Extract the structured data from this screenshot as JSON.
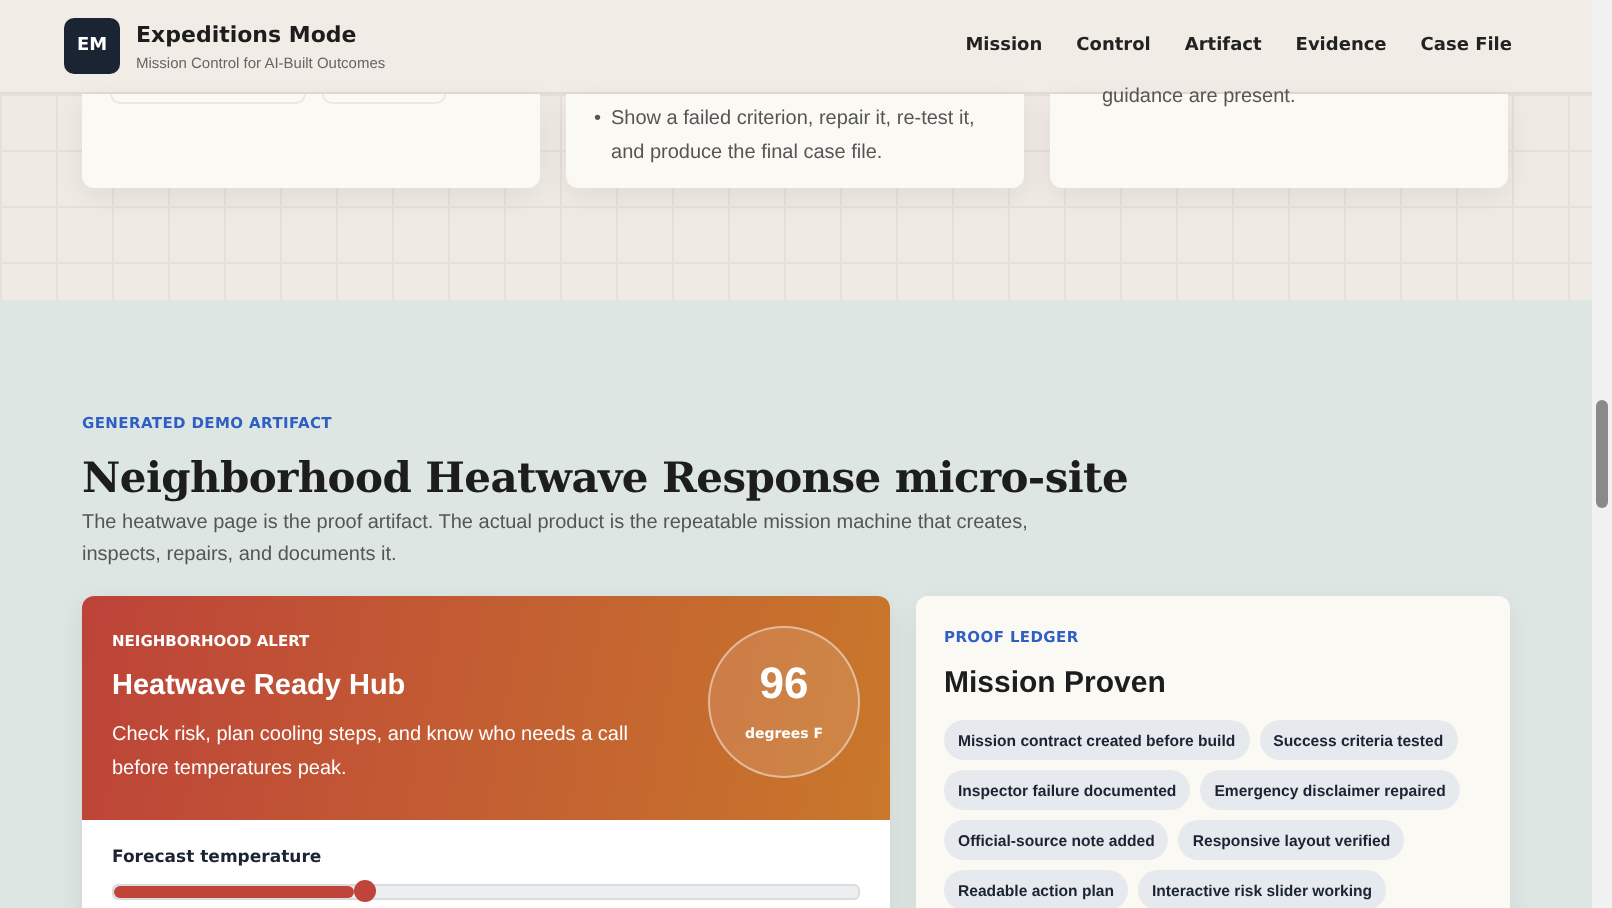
{
  "app": {
    "logo": "EM",
    "title": "Expeditions Mode",
    "subtitle": "Mission Control for AI-Built Outcomes"
  },
  "nav": [
    {
      "label": "Mission"
    },
    {
      "label": "Control"
    },
    {
      "label": "Artifact"
    },
    {
      "label": "Evidence"
    },
    {
      "label": "Case File"
    }
  ],
  "top_cards": [
    {
      "kind": "pills"
    },
    {
      "kind": "bullets",
      "marker": "•",
      "items": [
        "Show a failed criterion, repair it, re-test it, and produce the final case file."
      ]
    },
    {
      "kind": "text",
      "text": "guidance are present."
    }
  ],
  "artifact": {
    "eyebrow": "GENERATED DEMO ARTIFACT",
    "title": "Neighborhood Heatwave Response micro-site",
    "intro": "The heatwave page is the proof artifact. The actual product is the repeatable mission machine that creates, inspects, repairs, and documents it.",
    "hub": {
      "eyebrow": "NEIGHBORHOOD ALERT",
      "title": "Heatwave Ready Hub",
      "text": "Check risk, plan cooling steps, and know who needs a call before temperatures peak.",
      "temperature": "96",
      "unit": "degrees F",
      "slider": {
        "label": "Forecast temperature",
        "level": 0.34
      }
    },
    "ledger": {
      "eyebrow": "PROOF LEDGER",
      "title": "Mission Proven",
      "badges": [
        "Mission contract created before build",
        "Success criteria tested",
        "Inspector failure documented",
        "Emergency disclaimer repaired",
        "Official-source note added",
        "Responsive layout verified",
        "Readable action plan",
        "Interactive risk slider working"
      ]
    }
  }
}
